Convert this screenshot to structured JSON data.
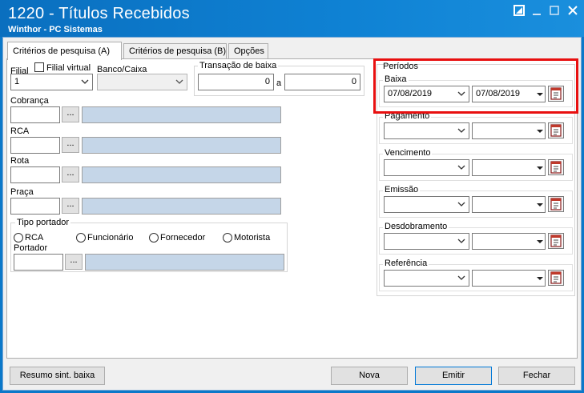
{
  "window": {
    "title": "1220 - Títulos Recebidos",
    "subtitle": "Winthor - PC Sistemas"
  },
  "tabs": [
    {
      "label": "Critérios de pesquisa (A)",
      "active": true
    },
    {
      "label": "Critérios de pesquisa (B)",
      "active": false
    },
    {
      "label": "Opções",
      "active": false
    }
  ],
  "filters": {
    "filial_label": "Filial",
    "filial_virtual_label": "Filial virtual",
    "filial_value": "1",
    "banco_caixa_label": "Banco/Caixa",
    "transacao_label": "Transação de baixa",
    "transacao_from": "0",
    "transacao_to": "0",
    "transacao_sep": "a",
    "cobranca_label": "Cobrança",
    "rca_label": "RCA",
    "rota_label": "Rota",
    "praca_label": "Praça",
    "dots": "...",
    "tipo_portador_label": "Tipo portador",
    "radio_options": [
      "RCA",
      "Funcionário",
      "Fornecedor",
      "Motorista"
    ],
    "portador_label": "Portador"
  },
  "periodos": {
    "title": "Períodos",
    "groups": [
      {
        "label": "Baixa",
        "from": "07/08/2019",
        "to": "07/08/2019"
      },
      {
        "label": "Pagamento",
        "from": "",
        "to": ""
      },
      {
        "label": "Vencimento",
        "from": "",
        "to": ""
      },
      {
        "label": "Emissão",
        "from": "",
        "to": ""
      },
      {
        "label": "Desdobramento",
        "from": "",
        "to": ""
      },
      {
        "label": "Referência",
        "from": "",
        "to": ""
      }
    ]
  },
  "buttons": {
    "resumo": "Resumo sint. baixa",
    "nova": "Nova",
    "emitir": "Emitir",
    "fechar": "Fechar"
  },
  "colors": {
    "titlebar": "#0f82d4",
    "highlight": "#e81010",
    "readonly_field": "#c5d6e8"
  }
}
